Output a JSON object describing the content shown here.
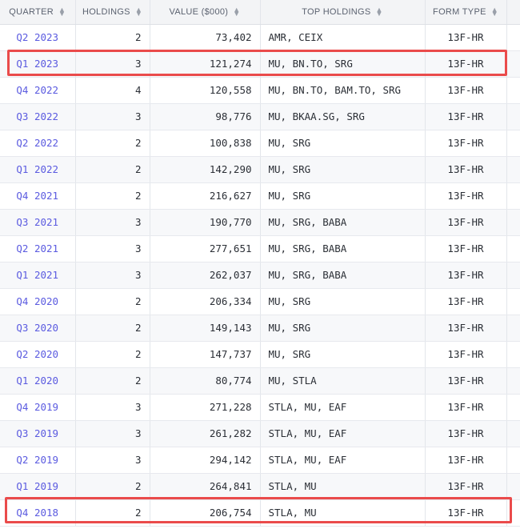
{
  "columns": [
    {
      "label": "QUARTER"
    },
    {
      "label": "HOLDINGS"
    },
    {
      "label": "VALUE ($000)"
    },
    {
      "label": "TOP HOLDINGS"
    },
    {
      "label": "FORM TYPE"
    }
  ],
  "sort_icon": "sort-updown-icon",
  "rows": [
    {
      "quarter": "Q2 2023",
      "holdings": "2",
      "value": "73,402",
      "top": "AMR, CEIX",
      "form": "13F-HR"
    },
    {
      "quarter": "Q1 2023",
      "holdings": "3",
      "value": "121,274",
      "top": "MU, BN.TO, SRG",
      "form": "13F-HR"
    },
    {
      "quarter": "Q4 2022",
      "holdings": "4",
      "value": "120,558",
      "top": "MU, BN.TO, BAM.TO, SRG",
      "form": "13F-HR"
    },
    {
      "quarter": "Q3 2022",
      "holdings": "3",
      "value": "98,776",
      "top": "MU, BKAA.SG, SRG",
      "form": "13F-HR"
    },
    {
      "quarter": "Q2 2022",
      "holdings": "2",
      "value": "100,838",
      "top": "MU, SRG",
      "form": "13F-HR"
    },
    {
      "quarter": "Q1 2022",
      "holdings": "2",
      "value": "142,290",
      "top": "MU, SRG",
      "form": "13F-HR"
    },
    {
      "quarter": "Q4 2021",
      "holdings": "2",
      "value": "216,627",
      "top": "MU, SRG",
      "form": "13F-HR"
    },
    {
      "quarter": "Q3 2021",
      "holdings": "3",
      "value": "190,770",
      "top": "MU, SRG, BABA",
      "form": "13F-HR"
    },
    {
      "quarter": "Q2 2021",
      "holdings": "3",
      "value": "277,651",
      "top": "MU, SRG, BABA",
      "form": "13F-HR"
    },
    {
      "quarter": "Q1 2021",
      "holdings": "3",
      "value": "262,037",
      "top": "MU, SRG, BABA",
      "form": "13F-HR"
    },
    {
      "quarter": "Q4 2020",
      "holdings": "2",
      "value": "206,334",
      "top": "MU, SRG",
      "form": "13F-HR"
    },
    {
      "quarter": "Q3 2020",
      "holdings": "2",
      "value": "149,143",
      "top": "MU, SRG",
      "form": "13F-HR"
    },
    {
      "quarter": "Q2 2020",
      "holdings": "2",
      "value": "147,737",
      "top": "MU, SRG",
      "form": "13F-HR"
    },
    {
      "quarter": "Q1 2020",
      "holdings": "2",
      "value": "80,774",
      "top": "MU, STLA",
      "form": "13F-HR"
    },
    {
      "quarter": "Q4 2019",
      "holdings": "3",
      "value": "271,228",
      "top": "STLA, MU, EAF",
      "form": "13F-HR"
    },
    {
      "quarter": "Q3 2019",
      "holdings": "3",
      "value": "261,282",
      "top": "STLA, MU, EAF",
      "form": "13F-HR"
    },
    {
      "quarter": "Q2 2019",
      "holdings": "3",
      "value": "294,142",
      "top": "STLA, MU, EAF",
      "form": "13F-HR"
    },
    {
      "quarter": "Q1 2019",
      "holdings": "2",
      "value": "264,841",
      "top": "STLA, MU",
      "form": "13F-HR"
    },
    {
      "quarter": "Q4 2018",
      "holdings": "2",
      "value": "206,754",
      "top": "STLA, MU",
      "form": "13F-HR"
    }
  ],
  "highlighted_rows": [
    "Q1 2023",
    "Q4 2018"
  ],
  "colors": {
    "link": "#5b5be0",
    "highlight": "#ea4b4b",
    "header_bg": "#f3f4f6"
  }
}
